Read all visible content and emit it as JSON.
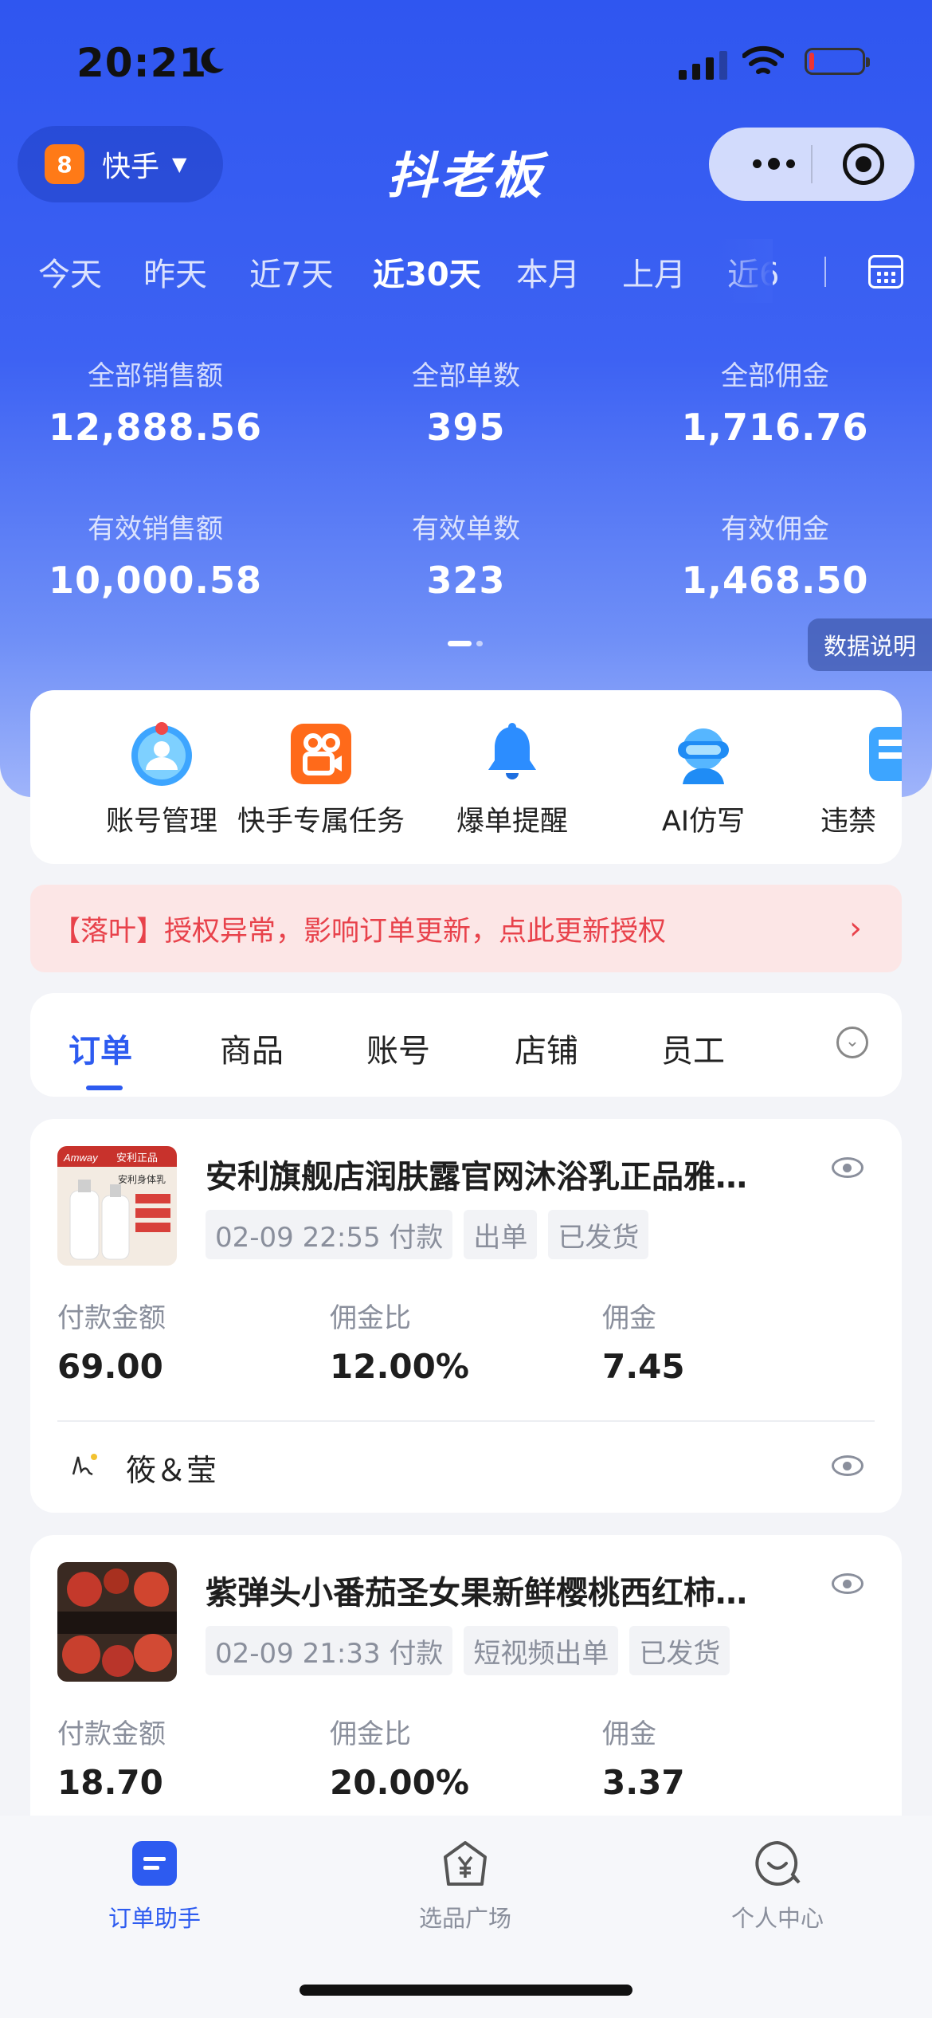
{
  "status_bar": {
    "time": "20:21"
  },
  "header": {
    "platform": "快手",
    "platform_icon": "kuaishou-icon",
    "brand": "抖老板"
  },
  "date_range": {
    "options": [
      "今天",
      "昨天",
      "近7天",
      "近30天",
      "本月",
      "上月",
      "近6"
    ],
    "selected": "近30天"
  },
  "stats": [
    {
      "label": "全部销售额",
      "value": "12,888.56"
    },
    {
      "label": "全部单数",
      "value": "395"
    },
    {
      "label": "全部佣金",
      "value": "1,716.76"
    },
    {
      "label": "有效销售额",
      "value": "10,000.58"
    },
    {
      "label": "有效单数",
      "value": "323"
    },
    {
      "label": "有效佣金",
      "value": "1,468.50"
    }
  ],
  "data_note_label": "数据说明",
  "quick_actions": [
    {
      "label": "账号管理",
      "icon": "account-avatar-icon"
    },
    {
      "label": "快手专属任务",
      "icon": "kuaishou-task-icon"
    },
    {
      "label": "爆单提醒",
      "icon": "bell-icon"
    },
    {
      "label": "AI仿写",
      "icon": "ai-robot-icon"
    },
    {
      "label": "违禁",
      "icon": "prohibited-words-icon"
    }
  ],
  "alert": {
    "text": "【落叶】授权异常，影响订单更新，点此更新授权"
  },
  "tabs": {
    "items": [
      "订单",
      "商品",
      "账号",
      "店铺",
      "员工"
    ],
    "active": "订单"
  },
  "orders": [
    {
      "title": "安利旗舰店润肤露官网沐浴乳正品雅…",
      "thumb": {
        "brand": "Amway",
        "badge": "安利正品",
        "product": "安利身体乳"
      },
      "tags": [
        "02-09 22:55 付款",
        "出单",
        "已发货"
      ],
      "metric_labels": [
        "付款金额",
        "佣金比",
        "佣金"
      ],
      "metric_values": [
        "69.00",
        "12.00%",
        "7.45"
      ],
      "shop": "筱＆莹"
    },
    {
      "title": "紫弹头小番茄圣女果新鲜樱桃西红柿…",
      "tags": [
        "02-09 21:33 付款",
        "短视频出单",
        "已发货"
      ],
      "metric_labels": [
        "付款金额",
        "佣金比",
        "佣金"
      ],
      "metric_values": [
        "18.70",
        "20.00%",
        "3.37"
      ]
    }
  ],
  "bottom_nav": [
    {
      "label": "订单助手",
      "icon": "order-assistant-icon",
      "active": true
    },
    {
      "label": "选品广场",
      "icon": "product-square-icon",
      "active": false
    },
    {
      "label": "个人中心",
      "icon": "profile-chat-icon",
      "active": false
    }
  ],
  "colors": {
    "primary": "#2d5bf0",
    "alert_text": "#e8424b",
    "alert_bg": "#fce6e6",
    "kuaishou": "#ff7a17"
  }
}
